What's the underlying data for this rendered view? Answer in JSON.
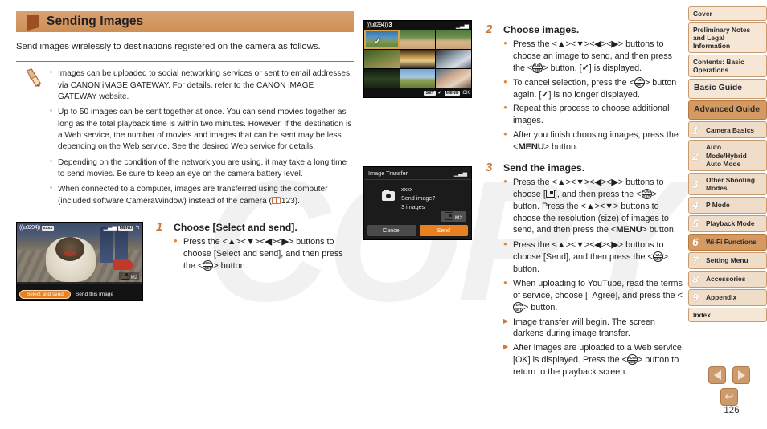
{
  "page": {
    "number": "126",
    "watermark": "COPY"
  },
  "section": {
    "title": "Sending Images",
    "intro": "Send images wirelessly to destinations registered on the camera as follows.",
    "marker_color": "#9c4f22",
    "header_color": "#d79b63"
  },
  "note": {
    "icon": "pencil-icon",
    "items": [
      "Images can be uploaded to social networking services or sent to email addresses, via CANON iMAGE GATEWAY. For details, refer to the CANON iMAGE GATEWAY website.",
      "Up to 50 images can be sent together at once. You can send movies together as long as the total playback time is within two minutes. However, if the destination is a Web service, the number of movies and images that can be sent may be less depending on the Web service. See the desired Web service for details.",
      "Depending on the condition of the network you are using, it may take a long time to send movies. Be sure to keep an eye on the camera battery level."
    ],
    "last_item_prefix": "When connected to a computer, images are transferred using the computer (included software CameraWindow) instead of the camera (",
    "last_item_ref": "123",
    "last_item_suffix": ")."
  },
  "steps": [
    {
      "num": "1",
      "title": "Choose [Select and send].",
      "bullets": [
        {
          "kind": "dot",
          "parts": [
            "Press the <",
            "▲",
            "><",
            "▼",
            "><",
            "◀",
            "><",
            "▶",
            "> buttons to choose [Select and send], and then press the <",
            "FUNC/SET",
            "> button."
          ]
        }
      ]
    },
    {
      "num": "2",
      "title": "Choose images.",
      "bullets": [
        {
          "kind": "dot",
          "text": "Press the <▲><▼><◀><▶> buttons to choose an image to send, and then press the <FUNC/SET> button. [✓] is displayed."
        },
        {
          "kind": "dot",
          "text": "To cancel selection, press the <FUNC/SET> button again. [✓] is no longer displayed."
        },
        {
          "kind": "dot",
          "text": "Repeat this process to choose additional images."
        },
        {
          "kind": "dot",
          "text": "After you finish choosing images, press the <MENU> button."
        }
      ]
    },
    {
      "num": "3",
      "title": "Send the images.",
      "bullets": [
        {
          "kind": "dot",
          "text": "Press the <▲><▼><◀><▶> buttons to choose [resize], and then press the <FUNC/SET> button. Press the <▲><▼> buttons to choose the resolution (size) of images to send, and then press the <MENU> button."
        },
        {
          "kind": "dot",
          "text": "Press the <▲><▼><◀><▶> buttons to choose [Send], and then press the <FUNC/SET> button."
        },
        {
          "kind": "dot",
          "text": "When uploading to YouTube, read the terms of service, choose [I Agree], and press the <FUNC/SET> button."
        },
        {
          "kind": "arrow",
          "text": "Image transfer will begin. The screen darkens during image transfer."
        },
        {
          "kind": "arrow",
          "text": "After images are uploaded to a Web service, [OK] is displayed. Press the <FUNC/SET> button to return to the playback screen."
        }
      ]
    }
  ],
  "screens": {
    "select_send": {
      "name": "select-and-send-screen",
      "wifi_label": "xxxx",
      "signal_icon": "signal-bars-icon",
      "menu_tag": "MENU",
      "back_tag": "↰",
      "resolution_tag": "M2",
      "option_selected": "Select and send",
      "option_other": "Send this image"
    },
    "image_grid": {
      "name": "image-selection-grid-screen",
      "count": "3",
      "wifi_icon": "wifi-icon",
      "signal_icon": "signal-bars-icon",
      "set_tag": "SET",
      "check_glyph": "✓",
      "menu_tag": "MENU",
      "ok_tag": "OK",
      "selected_cells": [
        0
      ]
    },
    "image_transfer": {
      "name": "image-transfer-dialog-screen",
      "title": "Image Transfer",
      "signal_icon": "signal-bars-icon",
      "destination": "xxxx",
      "question": "Send image?",
      "count_line": "3 images",
      "resolution_tag": "M2",
      "cancel_label": "Cancel",
      "send_label": "Send",
      "send_color": "#e8801f"
    }
  },
  "sidebar": {
    "tabs": [
      {
        "label": "Cover",
        "num": null,
        "active": false,
        "big": false
      },
      {
        "label": "Preliminary Notes and Legal Information",
        "num": null,
        "active": false,
        "big": false
      },
      {
        "label": "Contents: Basic Operations",
        "num": null,
        "active": false,
        "big": false
      },
      {
        "label": "Basic Guide",
        "num": null,
        "active": false,
        "big": true
      },
      {
        "label": "Advanced Guide",
        "num": null,
        "active": true,
        "big": true
      },
      {
        "label": "Camera Basics",
        "num": "1",
        "active": false,
        "big": false
      },
      {
        "label": "Auto Mode/Hybrid Auto Mode",
        "num": "2",
        "active": false,
        "big": false
      },
      {
        "label": "Other Shooting Modes",
        "num": "3",
        "active": false,
        "big": false
      },
      {
        "label": "P Mode",
        "num": "4",
        "active": false,
        "big": false
      },
      {
        "label": "Playback Mode",
        "num": "5",
        "active": false,
        "big": false
      },
      {
        "label": "Wi-Fi Functions",
        "num": "6",
        "active": true,
        "big": false
      },
      {
        "label": "Setting Menu",
        "num": "7",
        "active": false,
        "big": false
      },
      {
        "label": "Accessories",
        "num": "8",
        "active": false,
        "big": false
      },
      {
        "label": "Appendix",
        "num": "9",
        "active": false,
        "big": false
      },
      {
        "label": "Index",
        "num": null,
        "active": false,
        "big": false
      }
    ]
  },
  "navigation": {
    "prev_icon": "arrow-left-icon",
    "next_icon": "arrow-right-icon",
    "back_icon": "return-arrow-icon",
    "back_glyph": "↩"
  }
}
